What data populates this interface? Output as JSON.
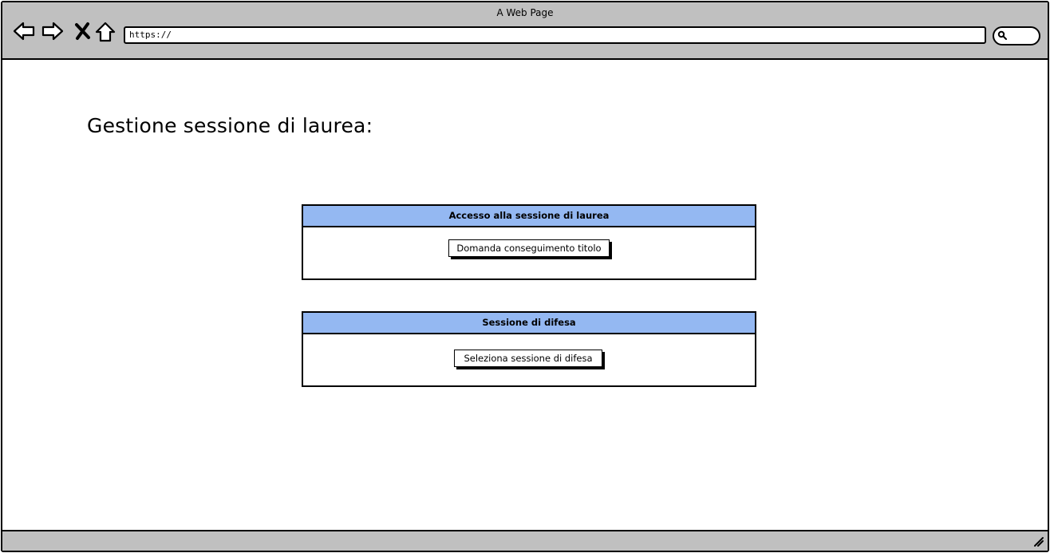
{
  "window": {
    "title": "A Web Page"
  },
  "toolbar": {
    "icons": [
      "back-arrow-icon",
      "forward-arrow-icon",
      "close-x-icon",
      "home-icon",
      "search-icon",
      "resize-handle-icon"
    ],
    "url": "https://"
  },
  "main": {
    "heading": "Gestione sessione di laurea:",
    "panels": [
      {
        "title": "Accesso alla sessione di laurea",
        "button_label": "Domanda conseguimento titolo"
      },
      {
        "title": "Sessione di difesa",
        "button_label": "Seleziona sessione di difesa"
      }
    ]
  },
  "colors": {
    "chrome": "#c0c0c0",
    "panel_header": "#94b8f2"
  }
}
